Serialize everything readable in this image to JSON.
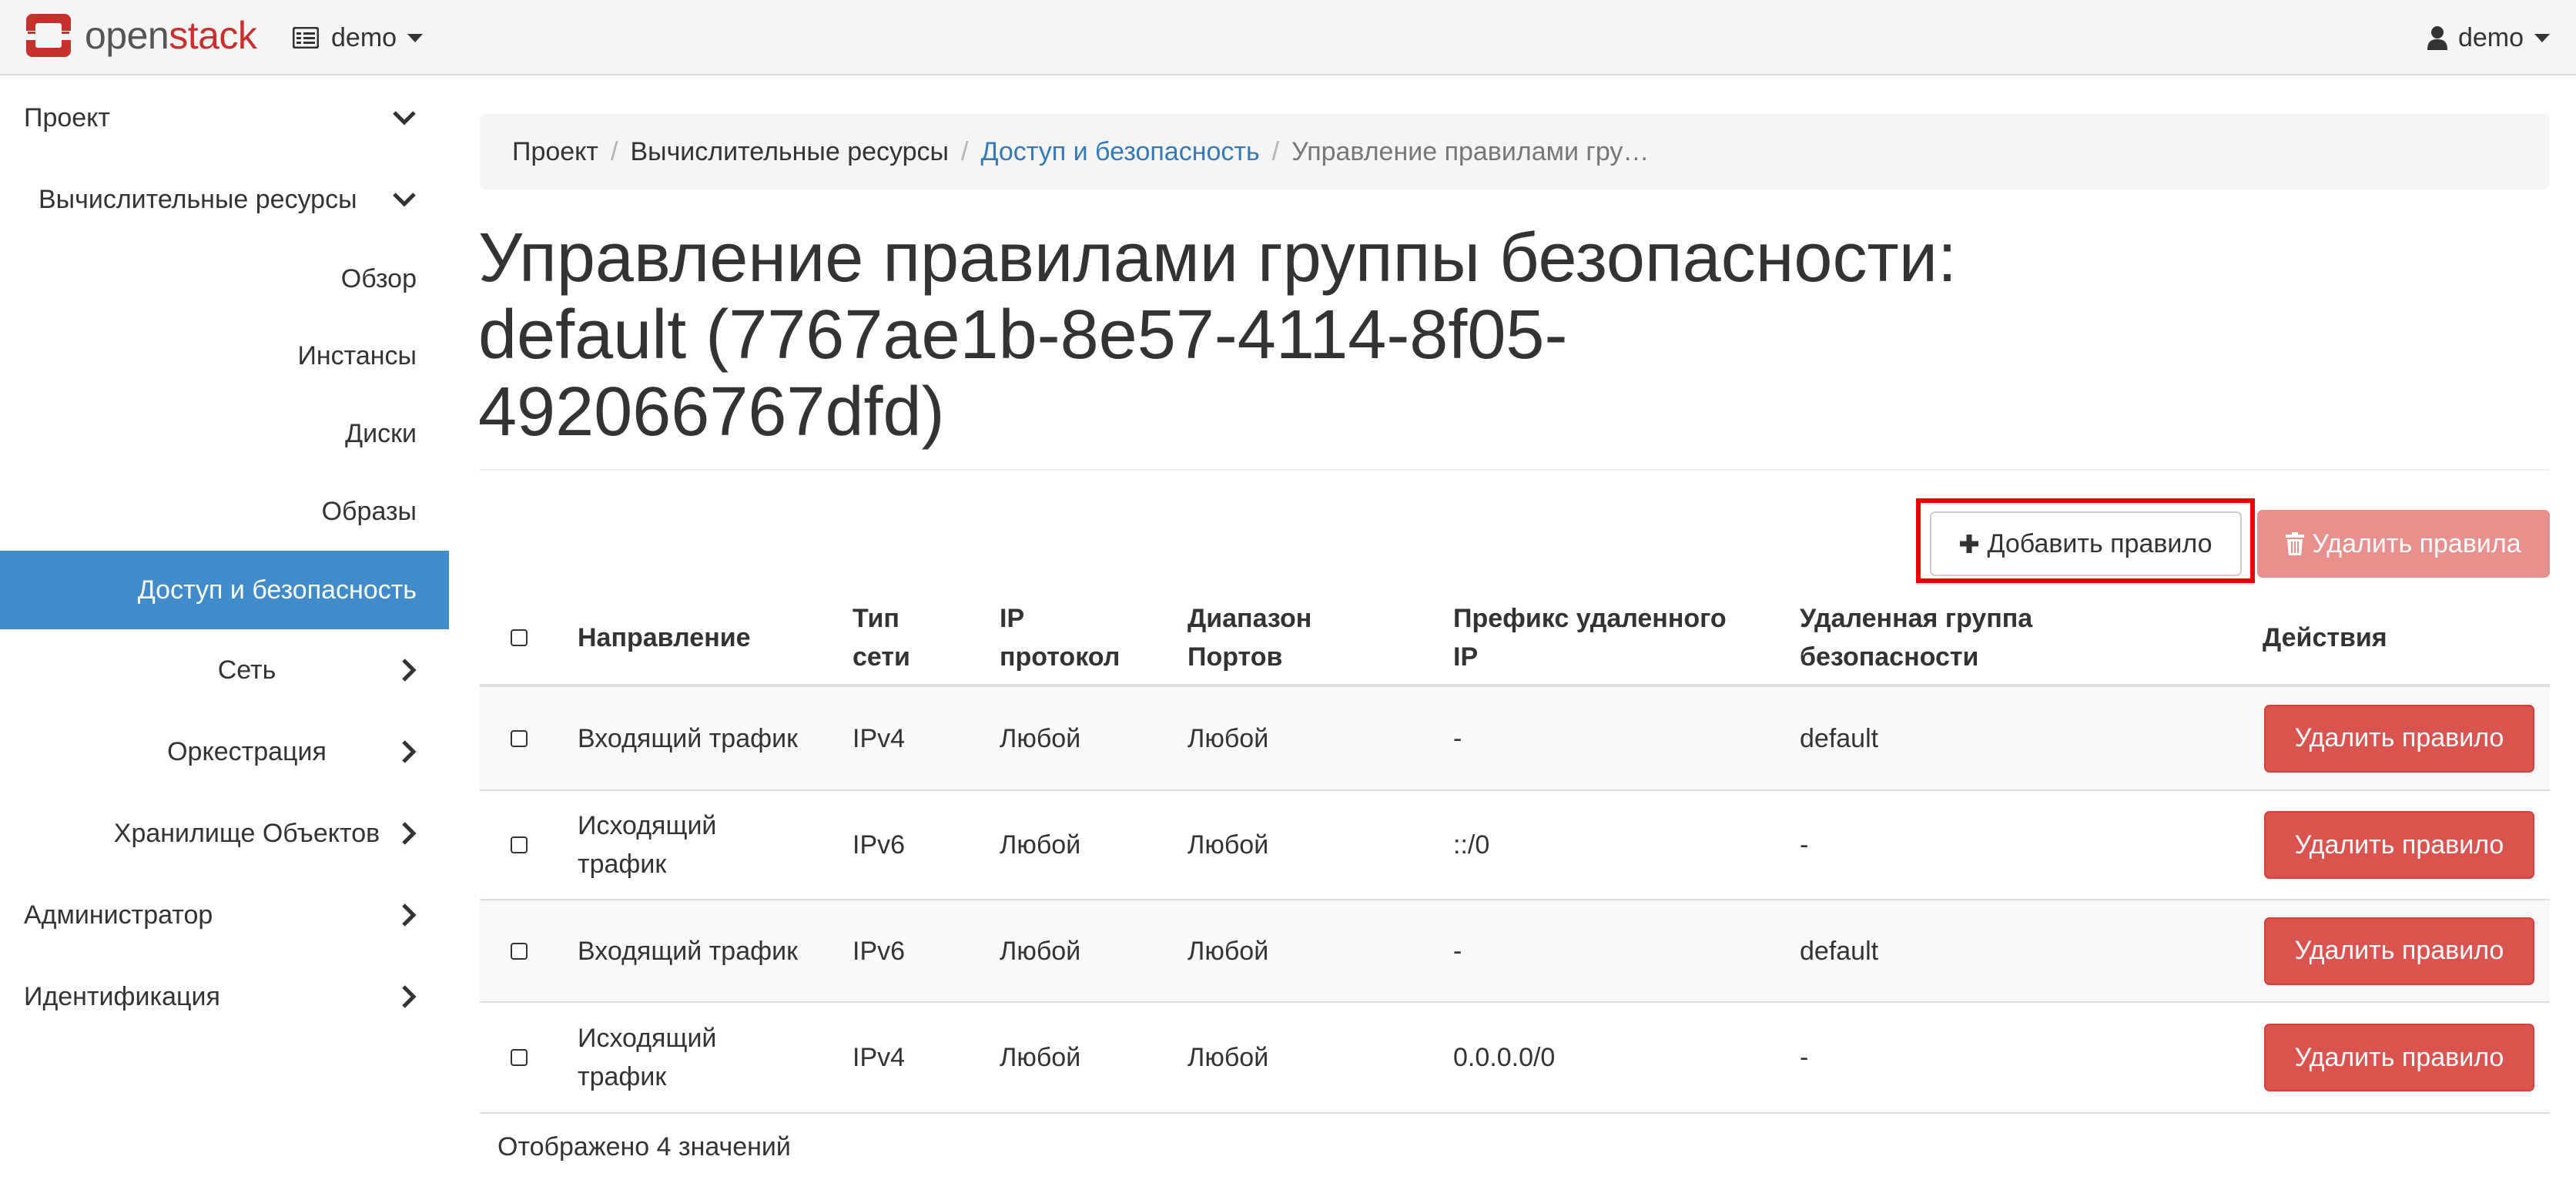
{
  "navbar": {
    "brand_prefix": "open",
    "brand_suffix": "stack",
    "project_label": "demo",
    "user_label": "demo"
  },
  "sidebar": {
    "items": [
      {
        "label": "Проект",
        "chevron": "down"
      },
      {
        "label": "Вычислительные ресурсы",
        "chevron": "down"
      },
      {
        "label": "Обзор"
      },
      {
        "label": "Инстансы"
      },
      {
        "label": "Диски"
      },
      {
        "label": "Образы"
      },
      {
        "label": "Доступ и безопасность",
        "active": true
      },
      {
        "label": "Сеть",
        "chevron": "right"
      },
      {
        "label": "Оркестрация",
        "chevron": "right"
      },
      {
        "label": "Хранилище Объектов",
        "chevron": "right"
      },
      {
        "label": "Администратор",
        "chevron": "right"
      },
      {
        "label": "Идентификация",
        "chevron": "right"
      }
    ]
  },
  "breadcrumb": {
    "items": [
      "Проект",
      "Вычислительные ресурсы",
      "Доступ и безопасность",
      "Управление правилами гру…"
    ],
    "separator": "/"
  },
  "page": {
    "title_line1": "Управление правилами группы безопасности:",
    "title_line2": "default (7767ae1b-8e57-4114-8f05-",
    "title_line3": "492066767dfd)"
  },
  "actions": {
    "add_rule": "Добавить правило",
    "delete_rules": "Удалить правила"
  },
  "table": {
    "headers": {
      "direction": "Направление",
      "ethertype_1": "Тип",
      "ethertype_2": "сети",
      "protocol_1": "IP",
      "protocol_2": "протокол",
      "ports_1": "Диапазон",
      "ports_2": "Портов",
      "prefix_1": "Префикс удаленного",
      "prefix_2": "IP",
      "group_1": "Удаленная группа",
      "group_2": "безопасности",
      "actions": "Действия"
    },
    "rows": [
      {
        "dir1": "Входящий трафик",
        "dir2": "",
        "ethertype": "IPv4",
        "protocol": "Любой",
        "ports": "Любой",
        "prefix": "-",
        "group": "default",
        "action": "Удалить правило"
      },
      {
        "dir1": "Исходящий",
        "dir2": "трафик",
        "ethertype": "IPv6",
        "protocol": "Любой",
        "ports": "Любой",
        "prefix": "::/0",
        "group": "-",
        "action": "Удалить правило"
      },
      {
        "dir1": "Входящий трафик",
        "dir2": "",
        "ethertype": "IPv6",
        "protocol": "Любой",
        "ports": "Любой",
        "prefix": "-",
        "group": "default",
        "action": "Удалить правило"
      },
      {
        "dir1": "Исходящий",
        "dir2": "трафик",
        "ethertype": "IPv4",
        "protocol": "Любой",
        "ports": "Любой",
        "prefix": "0.0.0.0/0",
        "group": "-",
        "action": "Удалить правило"
      }
    ],
    "footer": "Отображено 4 значений"
  },
  "colors": {
    "accent": "#428bca",
    "link": "#337ab7",
    "danger": "#d9534f",
    "danger_disabled": "#e8908e",
    "highlight": "#ee0000",
    "brand_red": "#c9302c"
  },
  "icons": {
    "project_switch": "server-icon",
    "user": "user-icon",
    "add": "plus-icon",
    "delete": "trash-icon"
  }
}
